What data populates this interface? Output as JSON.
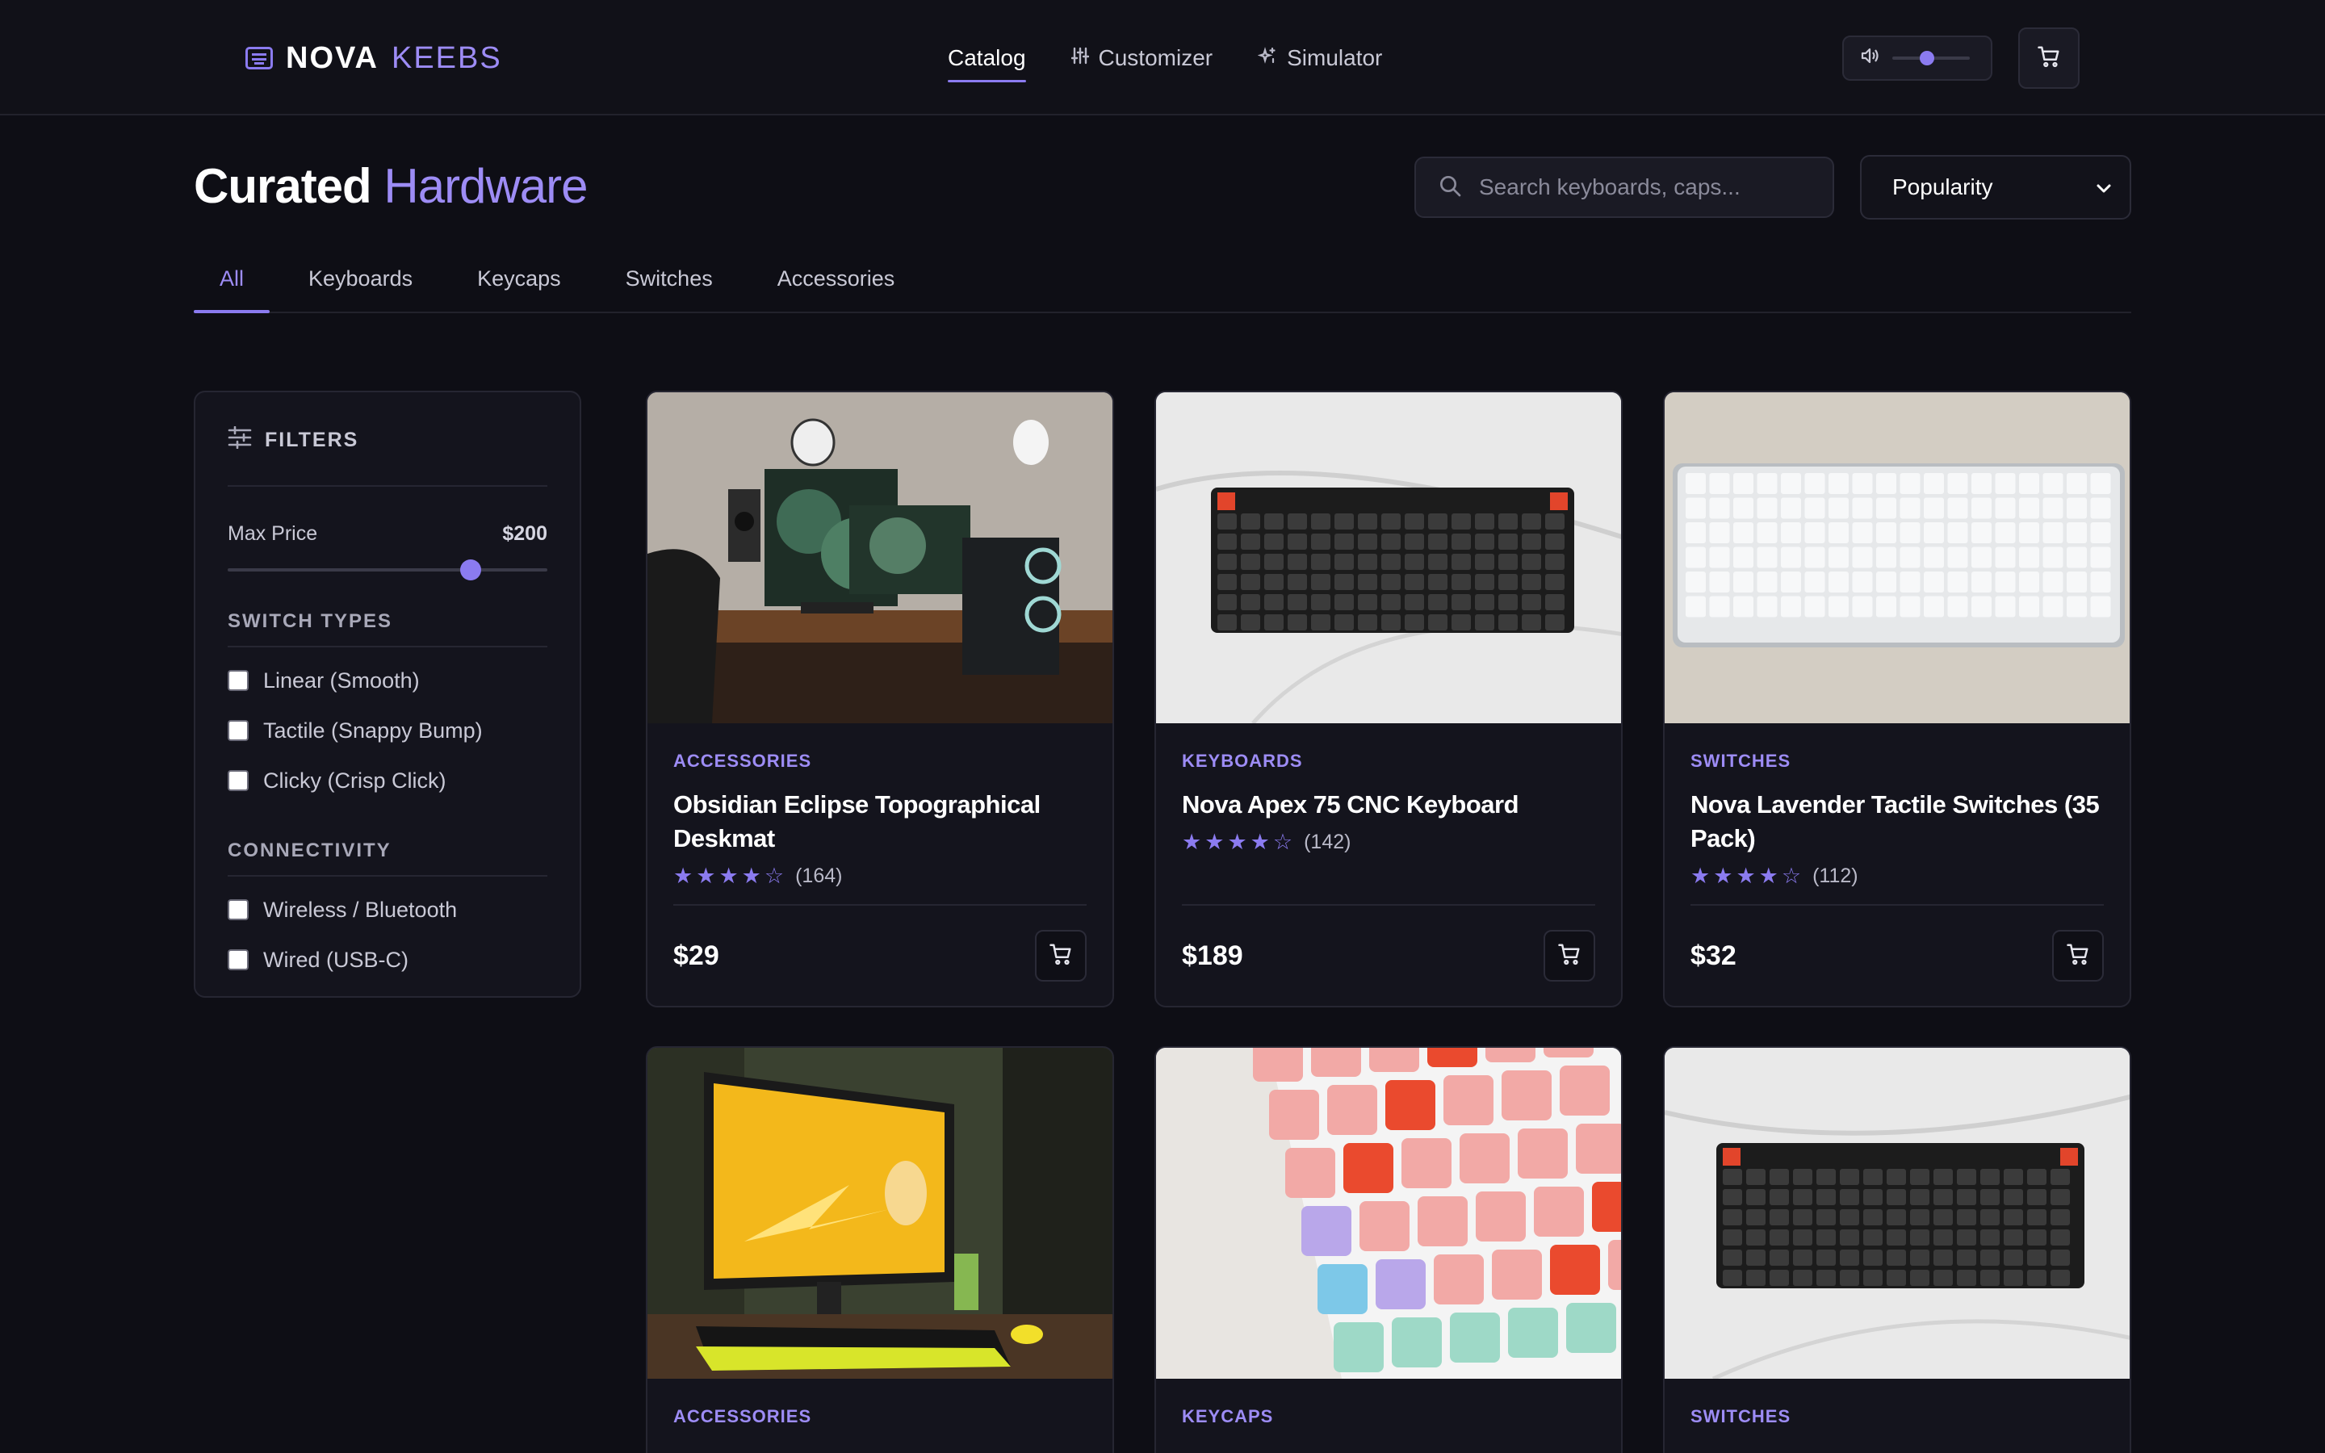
{
  "brand": {
    "part1": "NOVA",
    "part2": "KEEBS"
  },
  "nav": [
    {
      "label": "Catalog",
      "active": true,
      "icon": ""
    },
    {
      "label": "Customizer",
      "active": false,
      "icon": "sliders-icon"
    },
    {
      "label": "Simulator",
      "active": false,
      "icon": "sparkle-icon"
    }
  ],
  "sound": {
    "icon": "volume-icon",
    "level": 0.45
  },
  "header": {
    "title_a": "Curated",
    "title_b": "Hardware"
  },
  "search": {
    "placeholder": "Search keyboards, caps..."
  },
  "sort": {
    "selected": "Popularity"
  },
  "tabs": [
    "All",
    "Keyboards",
    "Keycaps",
    "Switches",
    "Accessories"
  ],
  "filters": {
    "title": "FILTERS",
    "max_price_label": "Max Price",
    "max_price_value": "$200",
    "max_price_fraction": 0.76,
    "switch_types_label": "SWITCH TYPES",
    "switch_types": [
      "Linear (Smooth)",
      "Tactile (Snappy Bump)",
      "Clicky (Crisp Click)"
    ],
    "connectivity_label": "CONNECTIVITY",
    "connectivity": [
      "Wireless / Bluetooth",
      "Wired (USB-C)"
    ]
  },
  "products": [
    {
      "category": "ACCESSORIES",
      "name": "Obsidian Eclipse Topographical Deskmat",
      "rating": 4,
      "reviews": "(164)",
      "price": "$29"
    },
    {
      "category": "KEYBOARDS",
      "name": "Nova Apex 75 CNC Keyboard",
      "rating": 4,
      "reviews": "(142)",
      "price": "$189"
    },
    {
      "category": "SWITCHES",
      "name": "Nova Lavender Tactile Switches (35 Pack)",
      "rating": 4,
      "reviews": "(112)",
      "price": "$32"
    },
    {
      "category": "ACCESSORIES"
    },
    {
      "category": "KEYCAPS"
    },
    {
      "category": "SWITCHES"
    }
  ],
  "colors": {
    "accent": "#8b7bf0",
    "background": "#0e0e15",
    "card": "#14141d"
  }
}
